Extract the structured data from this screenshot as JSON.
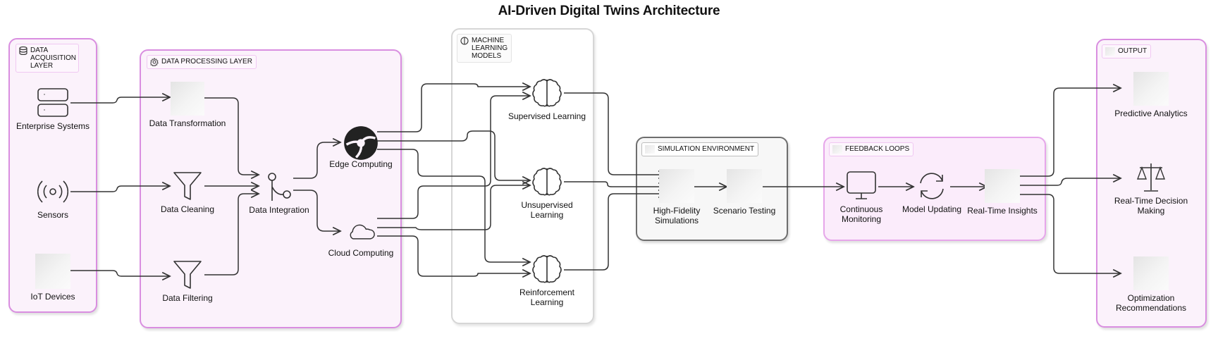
{
  "title": "AI-Driven Digital Twins Architecture",
  "groups": {
    "acquisition": {
      "label": "DATA ACQUISITION LAYER",
      "icon": "database-icon"
    },
    "processing": {
      "label": "DATA PROCESSING LAYER",
      "icon": "gear-icon"
    },
    "ml": {
      "label": "MACHINE LEARNING MODELS",
      "icon": "brain-icon"
    },
    "simulation": {
      "label": "SIMULATION ENVIRONMENT",
      "icon": "placeholder-icon"
    },
    "feedback": {
      "label": "FEEDBACK LOOPS",
      "icon": "placeholder-icon"
    },
    "output": {
      "label": "OUTPUT",
      "icon": "placeholder-icon"
    }
  },
  "nodes": {
    "enterprise": {
      "label": "Enterprise Systems",
      "icon": "server-stack-icon"
    },
    "sensors": {
      "label": "Sensors",
      "icon": "signal-icon"
    },
    "iot": {
      "label": "IoT Devices",
      "icon": "placeholder-icon"
    },
    "transformation": {
      "label": "Data Transformation",
      "icon": "placeholder-icon"
    },
    "cleaning": {
      "label": "Data Cleaning",
      "icon": "funnel-icon"
    },
    "filtering": {
      "label": "Data Filtering",
      "icon": "funnel-icon"
    },
    "integration": {
      "label": "Data Integration",
      "icon": "merge-icon"
    },
    "edge": {
      "label": "Edge Computing",
      "icon": "edge-logo-icon"
    },
    "cloud": {
      "label": "Cloud Computing",
      "icon": "cloud-icon"
    },
    "supervised": {
      "label": "Supervised Learning",
      "icon": "brain-icon"
    },
    "unsupervised": {
      "label": "Unsupervised Learning",
      "icon": "brain-icon"
    },
    "reinforcement": {
      "label": "Reinforcement Learning",
      "icon": "brain-icon"
    },
    "hifi": {
      "label": "High-Fidelity Simulations",
      "icon": "placeholder-icon"
    },
    "scenario": {
      "label": "Scenario Testing",
      "icon": "placeholder-icon"
    },
    "monitoring": {
      "label": "Continuous Monitoring",
      "icon": "monitor-icon"
    },
    "updating": {
      "label": "Model Updating",
      "icon": "refresh-icon"
    },
    "insights": {
      "label": "Real-Time Insights",
      "icon": "placeholder-icon"
    },
    "predictive": {
      "label": "Predictive Analytics",
      "icon": "placeholder-icon"
    },
    "decision": {
      "label": "Real-Time Decision Making",
      "icon": "scale-icon"
    },
    "optimization": {
      "label": "Optimization Recommendations",
      "icon": "placeholder-icon"
    }
  },
  "edges": [
    [
      "enterprise",
      "transformation"
    ],
    [
      "sensors",
      "cleaning"
    ],
    [
      "iot",
      "filtering"
    ],
    [
      "transformation",
      "integration"
    ],
    [
      "cleaning",
      "integration"
    ],
    [
      "filtering",
      "integration"
    ],
    [
      "integration",
      "edge"
    ],
    [
      "integration",
      "cloud"
    ],
    [
      "edge",
      "supervised"
    ],
    [
      "edge",
      "unsupervised"
    ],
    [
      "edge",
      "reinforcement"
    ],
    [
      "cloud",
      "supervised"
    ],
    [
      "cloud",
      "unsupervised"
    ],
    [
      "cloud",
      "reinforcement"
    ],
    [
      "supervised",
      "hifi"
    ],
    [
      "unsupervised",
      "hifi"
    ],
    [
      "reinforcement",
      "hifi"
    ],
    [
      "hifi",
      "scenario"
    ],
    [
      "scenario",
      "monitoring"
    ],
    [
      "monitoring",
      "updating"
    ],
    [
      "updating",
      "insights"
    ],
    [
      "insights",
      "predictive"
    ],
    [
      "insights",
      "decision"
    ],
    [
      "insights",
      "optimization"
    ]
  ],
  "colors": {
    "accent_border": "#d98ee0",
    "group_fill": "#fbf2fb",
    "stroke": "#333333"
  }
}
